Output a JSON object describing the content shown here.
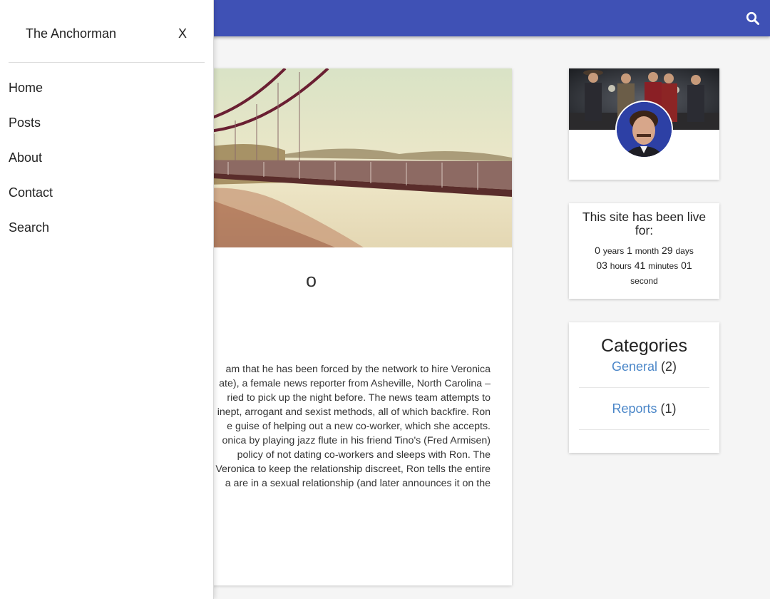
{
  "drawer": {
    "title": "The Anchorman",
    "close_label": "X",
    "nav": [
      "Home",
      "Posts",
      "About",
      "Contact",
      "Search"
    ]
  },
  "colors": {
    "header": "#3f51b5",
    "link": "#4a86c8"
  },
  "header": {
    "search_icon": "search-icon"
  },
  "post": {
    "title_fragment": "o",
    "body_lines": [
      "am that he has been forced by the network to hire Veronica",
      "ate), a female news reporter from Asheville, North Carolina –",
      "ried to pick up the night before. The news team attempts to",
      "inept, arrogant and sexist methods, all of which backfire. Ron",
      "e guise of helping out a new co-worker, which she accepts.",
      "onica by playing jazz flute in his friend Tino's (Fred Armisen)",
      " policy of not dating co-workers and sleeps with Ron. The",
      " Veronica to keep the relationship discreet, Ron tells the entire",
      "a are in a sexual relationship (and later announces it on the"
    ]
  },
  "live": {
    "title": "This site has been live for:",
    "years": "0",
    "years_label": "years",
    "months": "1",
    "months_label": "month",
    "days": "29",
    "days_label": "days",
    "hours": "03",
    "hours_label": "hours",
    "minutes": "41",
    "minutes_label": "minutes",
    "seconds": "01",
    "seconds_label": "second"
  },
  "categories": {
    "title": "Categories",
    "items": [
      {
        "name": "General",
        "count": "(2)"
      },
      {
        "name": "Reports",
        "count": "(1)"
      }
    ]
  }
}
